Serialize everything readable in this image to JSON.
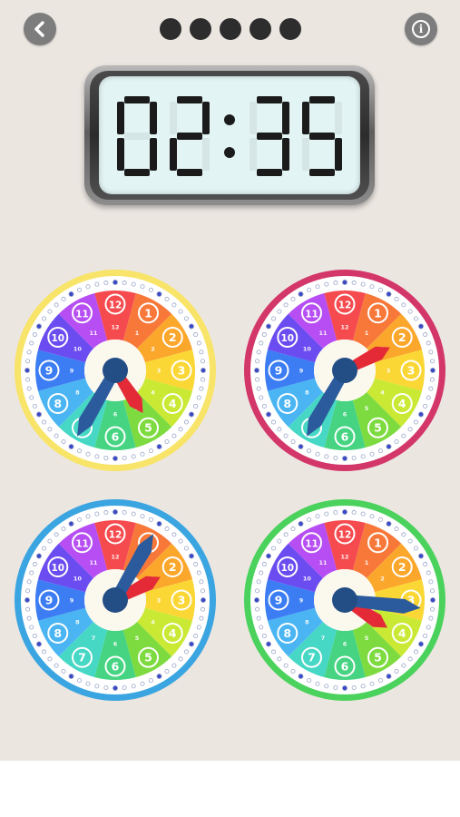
{
  "header": {
    "back_icon": "chevron-left-icon",
    "info_icon": "info-icon",
    "info_glyph": "i",
    "progress": {
      "total": 5,
      "completed": 5,
      "color": "#2d2d2d"
    }
  },
  "digital_clock": {
    "time": "02:35",
    "digits": [
      "0",
      "2",
      "3",
      "5"
    ],
    "separator": ":"
  },
  "clocks": [
    {
      "rim_color": "#f8e468",
      "hour": 4.9,
      "minute": 35
    },
    {
      "rim_color": "#d33669",
      "hour": 2.1,
      "minute": 35
    },
    {
      "rim_color": "#3aa5e0",
      "hour": 2.1,
      "minute": 5
    },
    {
      "rim_color": "#4bd25c",
      "hour": 4.1,
      "minute": 16
    }
  ],
  "dial": {
    "outer_numbers": [
      "12",
      "1",
      "2",
      "3",
      "4",
      "5",
      "6",
      "7",
      "8",
      "9",
      "10",
      "11"
    ],
    "inner_numbers": [
      "12",
      "1",
      "2",
      "3",
      "4",
      "5",
      "6",
      "7",
      "8",
      "9",
      "10",
      "11"
    ],
    "segment_colors": [
      "#f54a4e",
      "#f8783a",
      "#fba72c",
      "#fbd735",
      "#c9e934",
      "#7ddb3f",
      "#46d483",
      "#46d7c5",
      "#4ab5f2",
      "#3c7df3",
      "#6a4cf0",
      "#b64ef3",
      "#ed4bb8"
    ],
    "hour_hand_color": "#e32a36",
    "minute_hand_color": "#2b5b9c",
    "hub_color": "#234e85"
  }
}
